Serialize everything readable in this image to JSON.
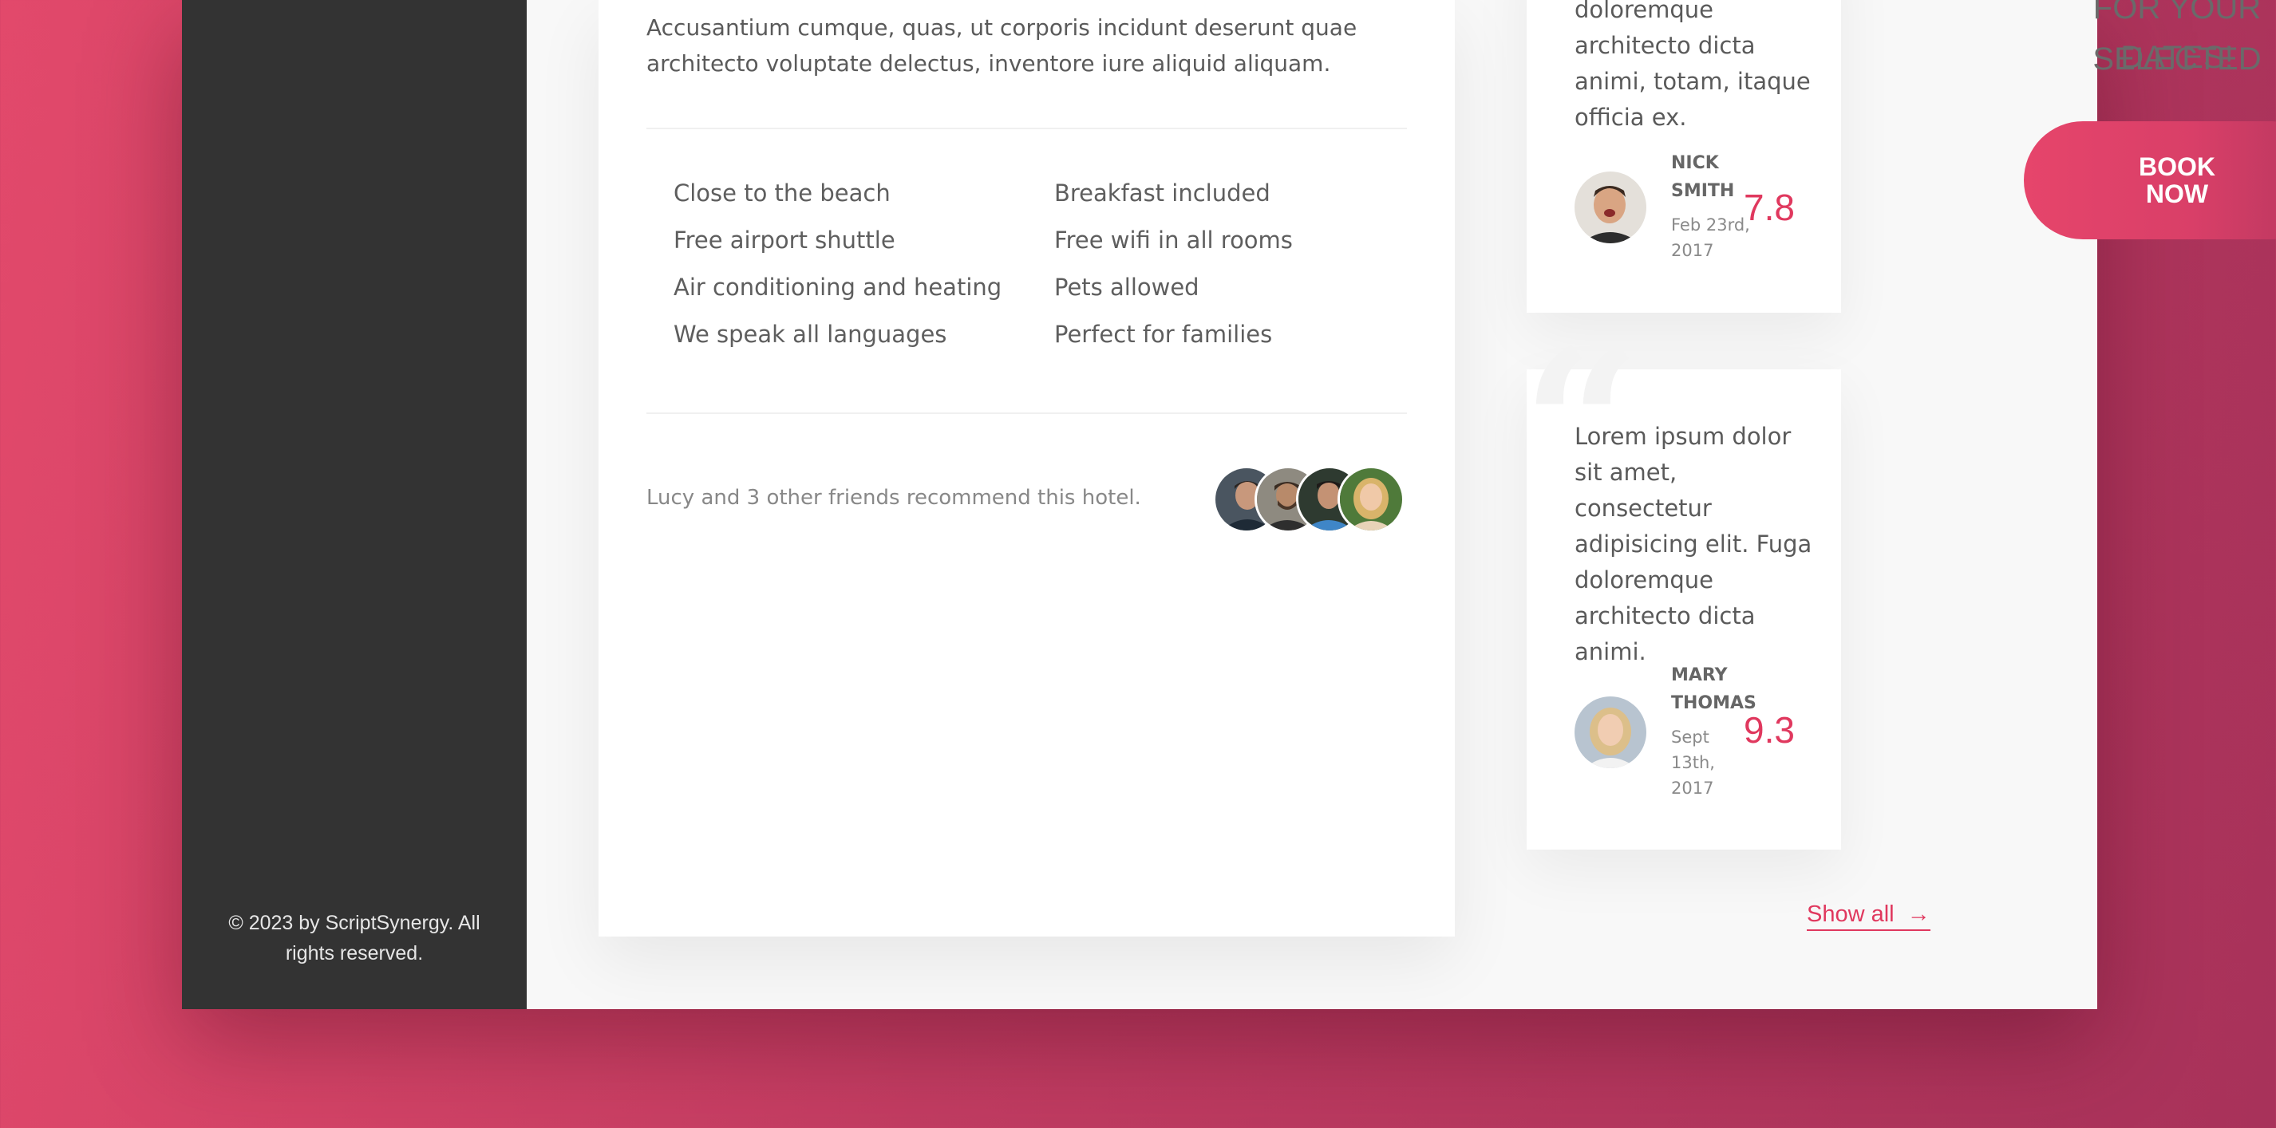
{
  "footer": {
    "copyright": "© 2023 by ScriptSynergy. All rights reserved."
  },
  "hotel": {
    "description": "Accusantium cumque, quas, ut corporis incidunt deserunt quae architecto voluptate delectus, inventore iure aliquid aliquam.",
    "amenities": [
      "Close to the beach",
      "Breakfast included",
      "Free airport shuttle",
      "Free wifi in all rooms",
      "Air conditioning and heating",
      "Pets allowed",
      "We speak all languages",
      "Perfect for families"
    ],
    "recommend_text": "Lucy and 3 other friends recommend this hotel.",
    "friend_avatars": [
      "friend-avatar-1",
      "friend-avatar-2",
      "friend-avatar-3",
      "friend-avatar-lucy"
    ]
  },
  "reviews": [
    {
      "text": "doloremque architecto dicta animi, totam, itaque officia ex.",
      "name": "Nick Smith",
      "date": "Feb 23rd, 2017",
      "score": "7.8"
    },
    {
      "text": "Lorem ipsum dolor sit amet, consectetur adipisicing elit. Fuga doloremque architecto dicta animi.",
      "name": "Mary Thomas",
      "date": "Sept 13th, 2017",
      "score": "9.3"
    }
  ],
  "show_all": {
    "label": "Show all",
    "arrow": "→"
  },
  "booking": {
    "heading_line1": "FOR YOUR SELECTED",
    "heading_line2": "DATES!",
    "button_label": "BOOK NOW"
  },
  "colors": {
    "accent": "#e0385e",
    "sidebar": "#333333",
    "background": "#c23c62"
  }
}
